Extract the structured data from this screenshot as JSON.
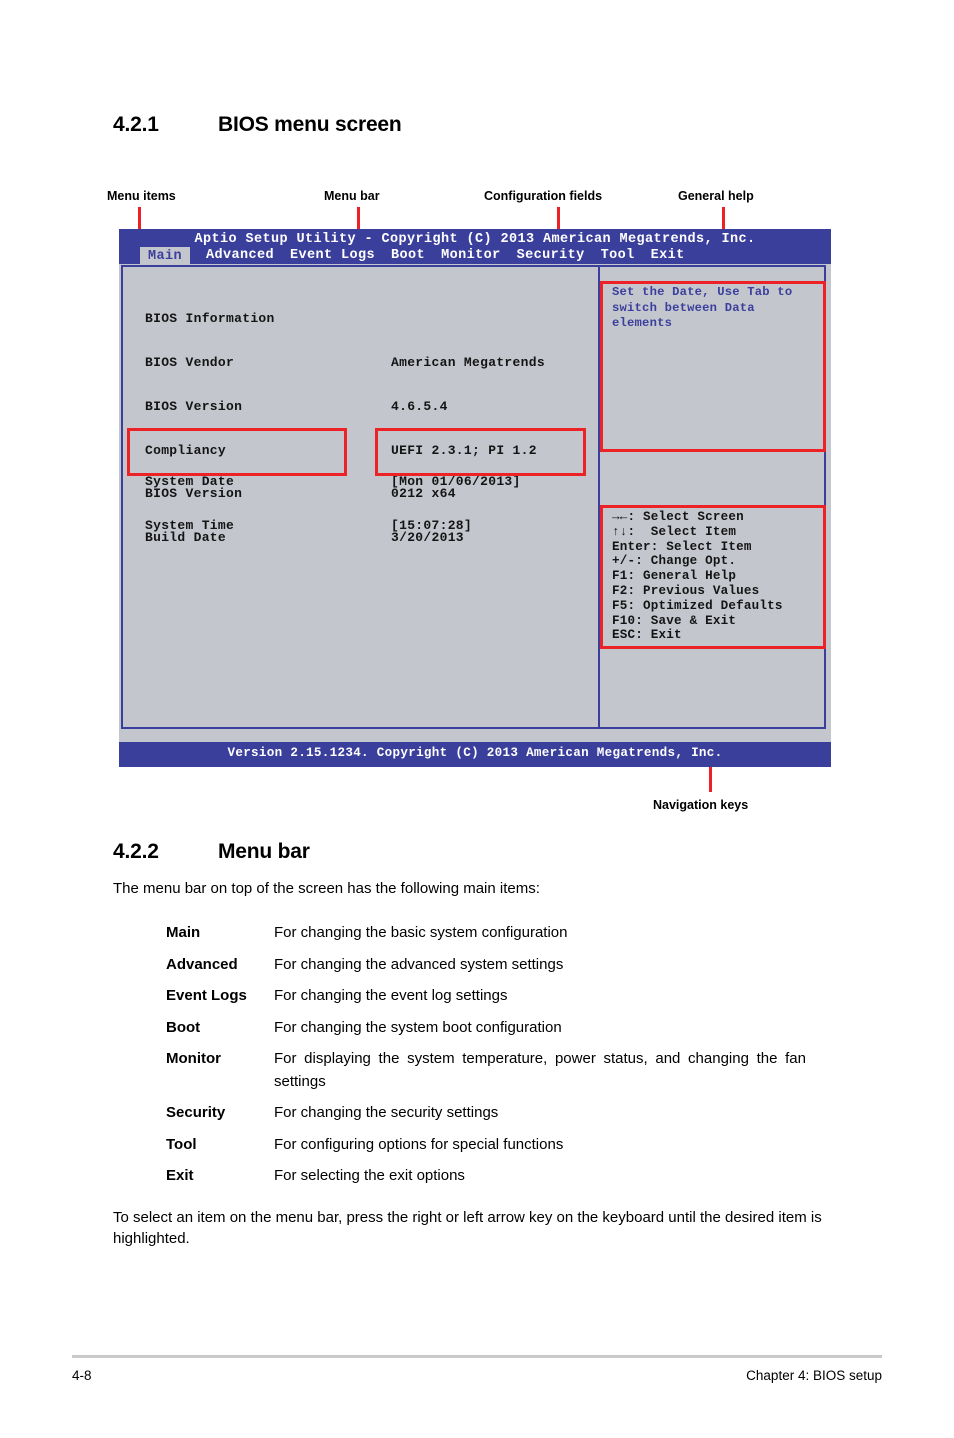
{
  "sections": {
    "s421": {
      "number": "4.2.1",
      "title": "BIOS menu screen"
    },
    "s422": {
      "number": "4.2.2",
      "title": "Menu bar"
    }
  },
  "callouts": {
    "menu_items": "Menu items",
    "menu_bar": "Menu bar",
    "configuration_fields": "Configuration fields",
    "general_help": "General help",
    "navigation_keys": "Navigation keys"
  },
  "bios": {
    "title": "Aptio Setup Utility - Copyright (C) 2013 American Megatrends, Inc.",
    "menu_tabs": [
      {
        "label": "Main",
        "active": true
      },
      {
        "label": "Advanced",
        "active": false
      },
      {
        "label": "Event Logs",
        "active": false
      },
      {
        "label": "Boot",
        "active": false
      },
      {
        "label": "Monitor",
        "active": false
      },
      {
        "label": "Security",
        "active": false
      },
      {
        "label": "Tool",
        "active": false
      },
      {
        "label": "Exit",
        "active": false
      }
    ],
    "info_heading": "BIOS Information",
    "info_rows": [
      {
        "label": "BIOS Vendor",
        "value": "American Megatrends"
      },
      {
        "label": "BIOS Version",
        "value": "4.6.5.4"
      },
      {
        "label": "Compliancy",
        "value": "UEFI 2.3.1; PI 1.2"
      },
      {
        "label": "BIOS Version",
        "value": "0212 x64"
      },
      {
        "label": "Build Date",
        "value": "3/20/2013"
      }
    ],
    "system_rows": [
      {
        "label": "System Date",
        "value": "[Mon 01/06/2013]"
      },
      {
        "label": "System Time",
        "value": "[15:07:28]"
      }
    ],
    "help_text": "Set the Date, Use Tab to\nswitch between Data elements",
    "nav_keys": [
      "→←: Select Screen",
      "↑↓:  Select Item",
      "Enter: Select Item",
      "+/-: Change Opt.",
      "F1: General Help",
      "F2: Previous Values",
      "F5: Optimized Defaults",
      "F10: Save & Exit",
      "ESC: Exit"
    ],
    "footer": "Version 2.15.1234. Copyright (C) 2013 American Megatrends, Inc."
  },
  "menu_bar_intro": "The menu bar on top of the screen has the following main items:",
  "menu_bar_items": [
    {
      "term": "Main",
      "desc": "For changing the basic system configuration"
    },
    {
      "term": "Advanced",
      "desc": "For changing the advanced system settings"
    },
    {
      "term": "Event Logs",
      "desc": "For changing the event log settings"
    },
    {
      "term": "Boot",
      "desc": "For changing the system boot configuration"
    },
    {
      "term": "Monitor",
      "desc": "For displaying the system temperature, power status, and changing the fan settings"
    },
    {
      "term": "Security",
      "desc": "For changing the security settings"
    },
    {
      "term": "Tool",
      "desc": "For configuring options for special functions"
    },
    {
      "term": "Exit",
      "desc": "For selecting the exit options"
    }
  ],
  "closing_paragraph": "To select an item on the menu bar, press the right or left arrow key on the keyboard until the desired item is highlighted.",
  "page_footer": {
    "left": "4-8",
    "right": "Chapter 4: BIOS setup"
  },
  "colors": {
    "bios_blue": "#3b3f9c",
    "bios_gray": "#c3c6cd",
    "annotation_red": "#ec2227"
  }
}
